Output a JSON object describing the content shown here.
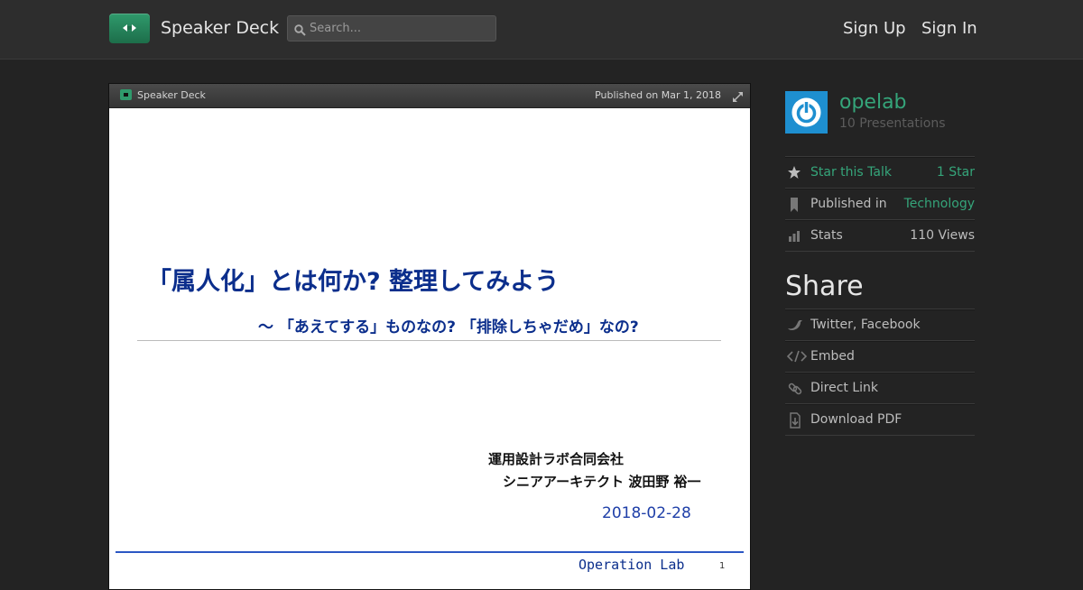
{
  "header": {
    "brand": "Speaker Deck",
    "search_placeholder": "Search...",
    "signup": "Sign Up",
    "signin": "Sign In"
  },
  "slide_bar": {
    "brand": "Speaker Deck",
    "published": "Published on Mar 1, 2018"
  },
  "slide": {
    "title": "「属人化」とは何か? 整理してみよう",
    "subtitle": "〜 「あえてする」ものなの? 「排除しちゃだめ」なの?",
    "org": "運用設計ラボ合同会社",
    "person": "シニアアーキテクト 波田野 裕一",
    "date": "2018-02-28",
    "footer": "Operation Lab",
    "page": "1"
  },
  "sidebar": {
    "user_name": "opelab",
    "user_meta": "10 Presentations",
    "star_label": "Star this Talk",
    "star_count": "1 Star",
    "published_label": "Published in",
    "published_value": "Technology",
    "stats_label": "Stats",
    "stats_value": "110 Views",
    "share_title": "Share",
    "share_items": [
      "Twitter, Facebook",
      "Embed",
      "Direct Link",
      "Download PDF"
    ]
  },
  "icons": {
    "logo": "speakerdeck-logo-icon",
    "search": "search-icon",
    "expand": "expand-icon",
    "star": "star-icon",
    "bookmark": "bookmark-icon",
    "stats": "bar-chart-icon",
    "twitter": "twitter-bird-icon",
    "embed": "code-icon",
    "link": "link-icon",
    "download": "download-icon",
    "avatar": "power-icon"
  },
  "colors": {
    "accent": "#35a57a",
    "slide_text": "#0b2e8c",
    "avatar_bg": "#1e8fd0",
    "page_bg": "#232323"
  }
}
